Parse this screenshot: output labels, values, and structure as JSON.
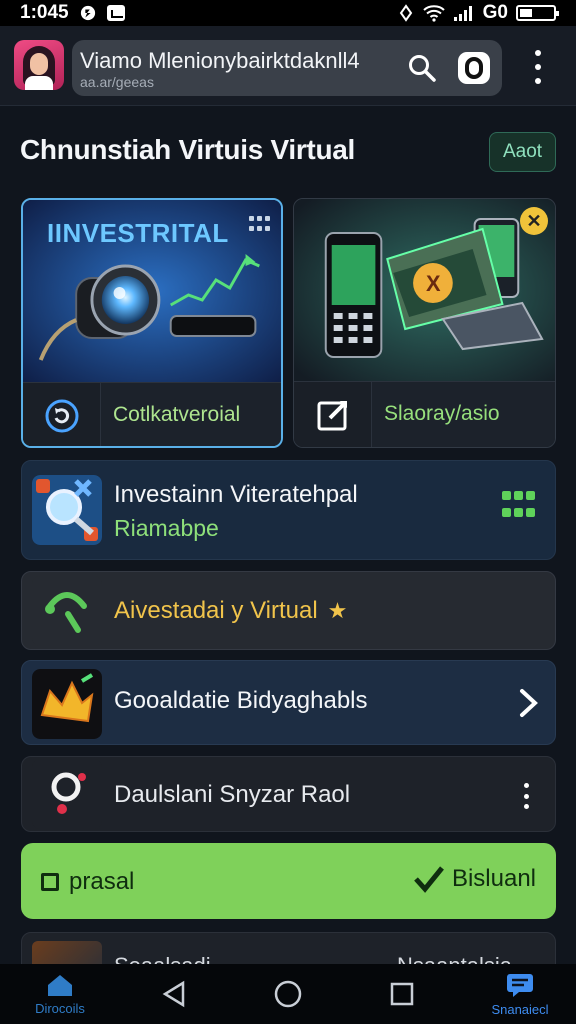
{
  "status_bar": {
    "time": "1:045"
  },
  "header": {
    "title": "Viamo Mlenionybairktdaknll4",
    "subtitle": "aa.ar/geeas"
  },
  "section": {
    "title": "Chnunstiah Virtuis Virtual",
    "action_label": "Aaot"
  },
  "cards": [
    {
      "banner": "IINVESTRITAL",
      "label": "Cotlkatveroial"
    },
    {
      "label": "Slaoray/asio"
    }
  ],
  "list": [
    {
      "title": "Investainn Viteratehpal",
      "subtitle": "Riamabpe"
    },
    {
      "title": "Aivestadai y Virtual",
      "star": "★"
    },
    {
      "title": "Gooaldatie Bidyaghabls"
    },
    {
      "title": "Daulslani Snyzar Raol"
    }
  ],
  "primary_button": {
    "left_label": "prasal",
    "right_label": "Bisluanl"
  },
  "partial_row": {
    "left_text": "Soaalsadi",
    "right_text": "Nsaantalsia"
  },
  "bottom_nav": {
    "home_label": "Dirocoils",
    "active_label": "Snanaiecl"
  },
  "colors": {
    "accent_green": "#7fd15a",
    "accent_blue": "#3e8cf0",
    "highlight_yellow": "#f1c44b"
  },
  "icons": [
    "wifi-icon",
    "signal-icon",
    "battery-icon",
    "search-icon",
    "o-button-icon",
    "more-icon",
    "grid-icon",
    "star-icon",
    "chevron-right-icon",
    "check-icon",
    "home-icon",
    "back-icon",
    "circle-home-icon",
    "square-recents-icon",
    "chat-icon"
  ]
}
